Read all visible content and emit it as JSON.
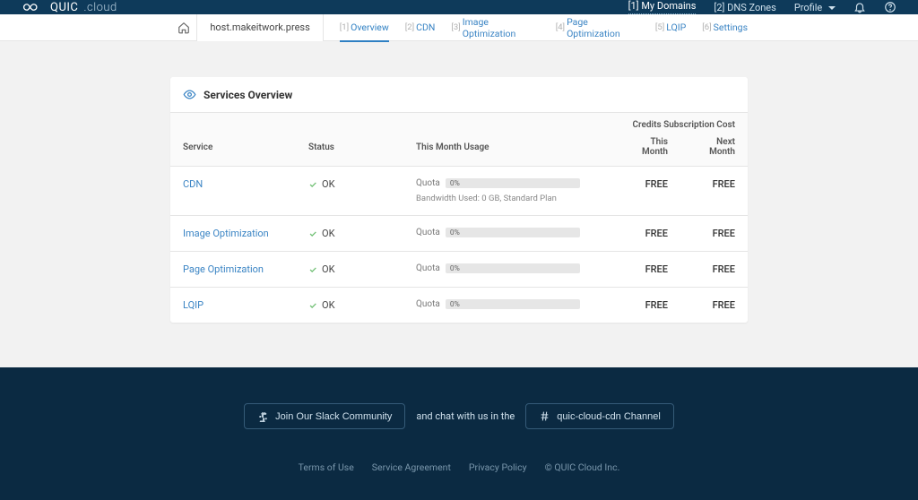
{
  "brand": {
    "name1": "QUIC",
    "name2": ".cloud"
  },
  "topnav": {
    "mydomains": {
      "num": "[1]",
      "label": "My Domains"
    },
    "dnszones": {
      "num": "[2]",
      "label": "DNS Zones"
    },
    "profile": {
      "label": "Profile"
    }
  },
  "tabbar": {
    "domain": "host.makeitwork.press",
    "tabs": [
      {
        "num": "[1]",
        "label": "Overview"
      },
      {
        "num": "[2]",
        "label": "CDN"
      },
      {
        "num": "[3]",
        "label": "Image Optimization"
      },
      {
        "num": "[4]",
        "label": "Page Optimization"
      },
      {
        "num": "[5]",
        "label": "LQIP"
      },
      {
        "num": "[6]",
        "label": "Settings"
      }
    ]
  },
  "card": {
    "title": "Services Overview"
  },
  "cols": {
    "service": "Service",
    "status": "Status",
    "usage": "This Month Usage",
    "subcost": "Credits Subscription Cost",
    "thismonth": "This Month",
    "nextmonth": "Next Month"
  },
  "common": {
    "quota_label": "Quota",
    "ok": "OK"
  },
  "rows": [
    {
      "name": "CDN",
      "status": "OK",
      "quota_pct": "0%",
      "bw": "Bandwidth Used: 0 GB,   Standard Plan",
      "this": "FREE",
      "next": "FREE"
    },
    {
      "name": "Image Optimization",
      "status": "OK",
      "quota_pct": "0%",
      "this": "FREE",
      "next": "FREE"
    },
    {
      "name": "Page Optimization",
      "status": "OK",
      "quota_pct": "0%",
      "this": "FREE",
      "next": "FREE"
    },
    {
      "name": "LQIP",
      "status": "OK",
      "quota_pct": "0%",
      "this": "FREE",
      "next": "FREE"
    }
  ],
  "footer": {
    "slack_btn": "Join Our Slack Community",
    "mid": "and chat with us in the",
    "channel_btn": "quic-cloud-cdn Channel",
    "terms": "Terms of Use",
    "agreement": "Service Agreement",
    "privacy": "Privacy Policy",
    "copyright": "© QUIC Cloud Inc."
  }
}
